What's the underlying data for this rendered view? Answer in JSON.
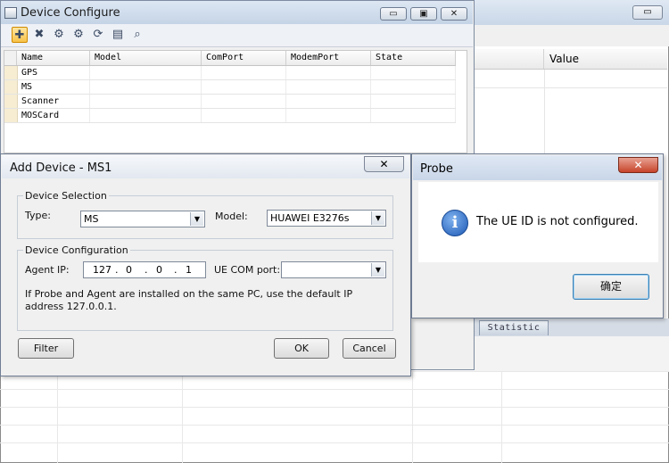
{
  "device_configure": {
    "title": "Device Configure",
    "window_buttons": {
      "minimize": "▭",
      "maximize": "▣",
      "close": "✕"
    },
    "toolbar_icons": [
      "add-device-icon",
      "delete-device-icon",
      "connect-icon",
      "disconnect-icon",
      "refresh-icon",
      "print-icon",
      "find-icon"
    ],
    "grid": {
      "columns": [
        "Name",
        "Model",
        "ComPort",
        "ModemPort",
        "State"
      ],
      "rows": [
        {
          "name": "GPS",
          "model": "",
          "comport": "",
          "modemport": "",
          "state": ""
        },
        {
          "name": "MS",
          "model": "",
          "comport": "",
          "modemport": "",
          "state": ""
        },
        {
          "name": "Scanner",
          "model": "",
          "comport": "",
          "modemport": "",
          "state": ""
        },
        {
          "name": "MOSCard",
          "model": "",
          "comport": "",
          "modemport": "",
          "state": ""
        }
      ]
    }
  },
  "background_panel": {
    "value_header": "Value",
    "statistic_tab": "Statistic",
    "window_buttons": {
      "minimize": "▭",
      "close": "✕"
    }
  },
  "add_device": {
    "title": "Add Device - MS1",
    "close": "✕",
    "selection": {
      "label": "Device Selection",
      "type_label": "Type:",
      "type_value": "MS",
      "model_label": "Model:",
      "model_value": "HUAWEI E3276s"
    },
    "configuration": {
      "label": "Device Configuration",
      "agent_ip_label": "Agent IP:",
      "ip": [
        "127",
        "0",
        "0",
        "1"
      ],
      "ue_com_label": "UE COM port:",
      "ue_com_value": "",
      "hint": "If Probe and Agent are installed on the same PC, use the default IP address 127.0.0.1."
    },
    "buttons": {
      "filter": "Filter",
      "ok": "OK",
      "cancel": "Cancel"
    }
  },
  "probe": {
    "title": "Probe",
    "close": "✕",
    "message": "The UE ID is not configured.",
    "ok_button": "确定"
  }
}
